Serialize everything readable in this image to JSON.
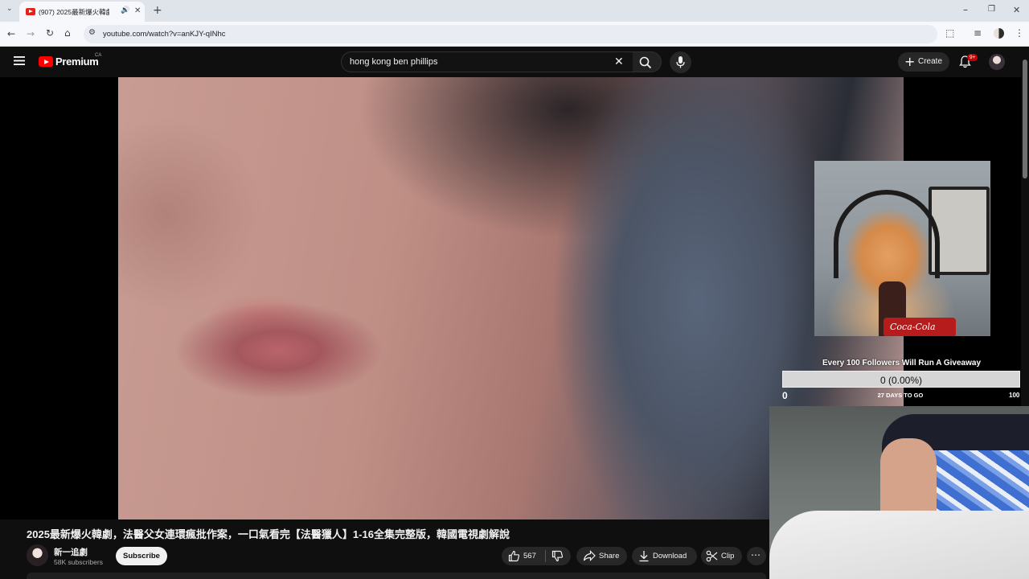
{
  "browser": {
    "tab": {
      "title": "(907) 2025最新爆火韓劇,",
      "mute_glyph": "🔊",
      "close_glyph": "✕"
    },
    "new_tab_glyph": "+",
    "url": "youtube.com/watch?v=anKJY-qINhc"
  },
  "youtube": {
    "logo_text": "Premium",
    "region": "CA",
    "search_value": "hong kong ben phillips",
    "create_label": "Create",
    "notification_count": "9+"
  },
  "overlay": {
    "cat_label": "Coca-Cola",
    "goal_title": "Every 100 Followers Will Run A Giveaway",
    "goal_value": "0 (0.00%)",
    "goal_progress": 0.0,
    "goal_min": "0",
    "goal_days": "27 DAYS TO GO",
    "goal_max": "100"
  },
  "video": {
    "title": "2025最新爆火韓劇，法醫父女連環瘋批作案，一口氣看完【法醫獵人】1-16全集完整版，韓國電視劇解說",
    "channel_name": "新一追劇",
    "subscribers": "58K subscribers",
    "subscribe_label": "Subscribe",
    "likes": "567",
    "share_label": "Share",
    "download_label": "Download",
    "clip_label": "Clip",
    "more_glyph": "⋯"
  }
}
